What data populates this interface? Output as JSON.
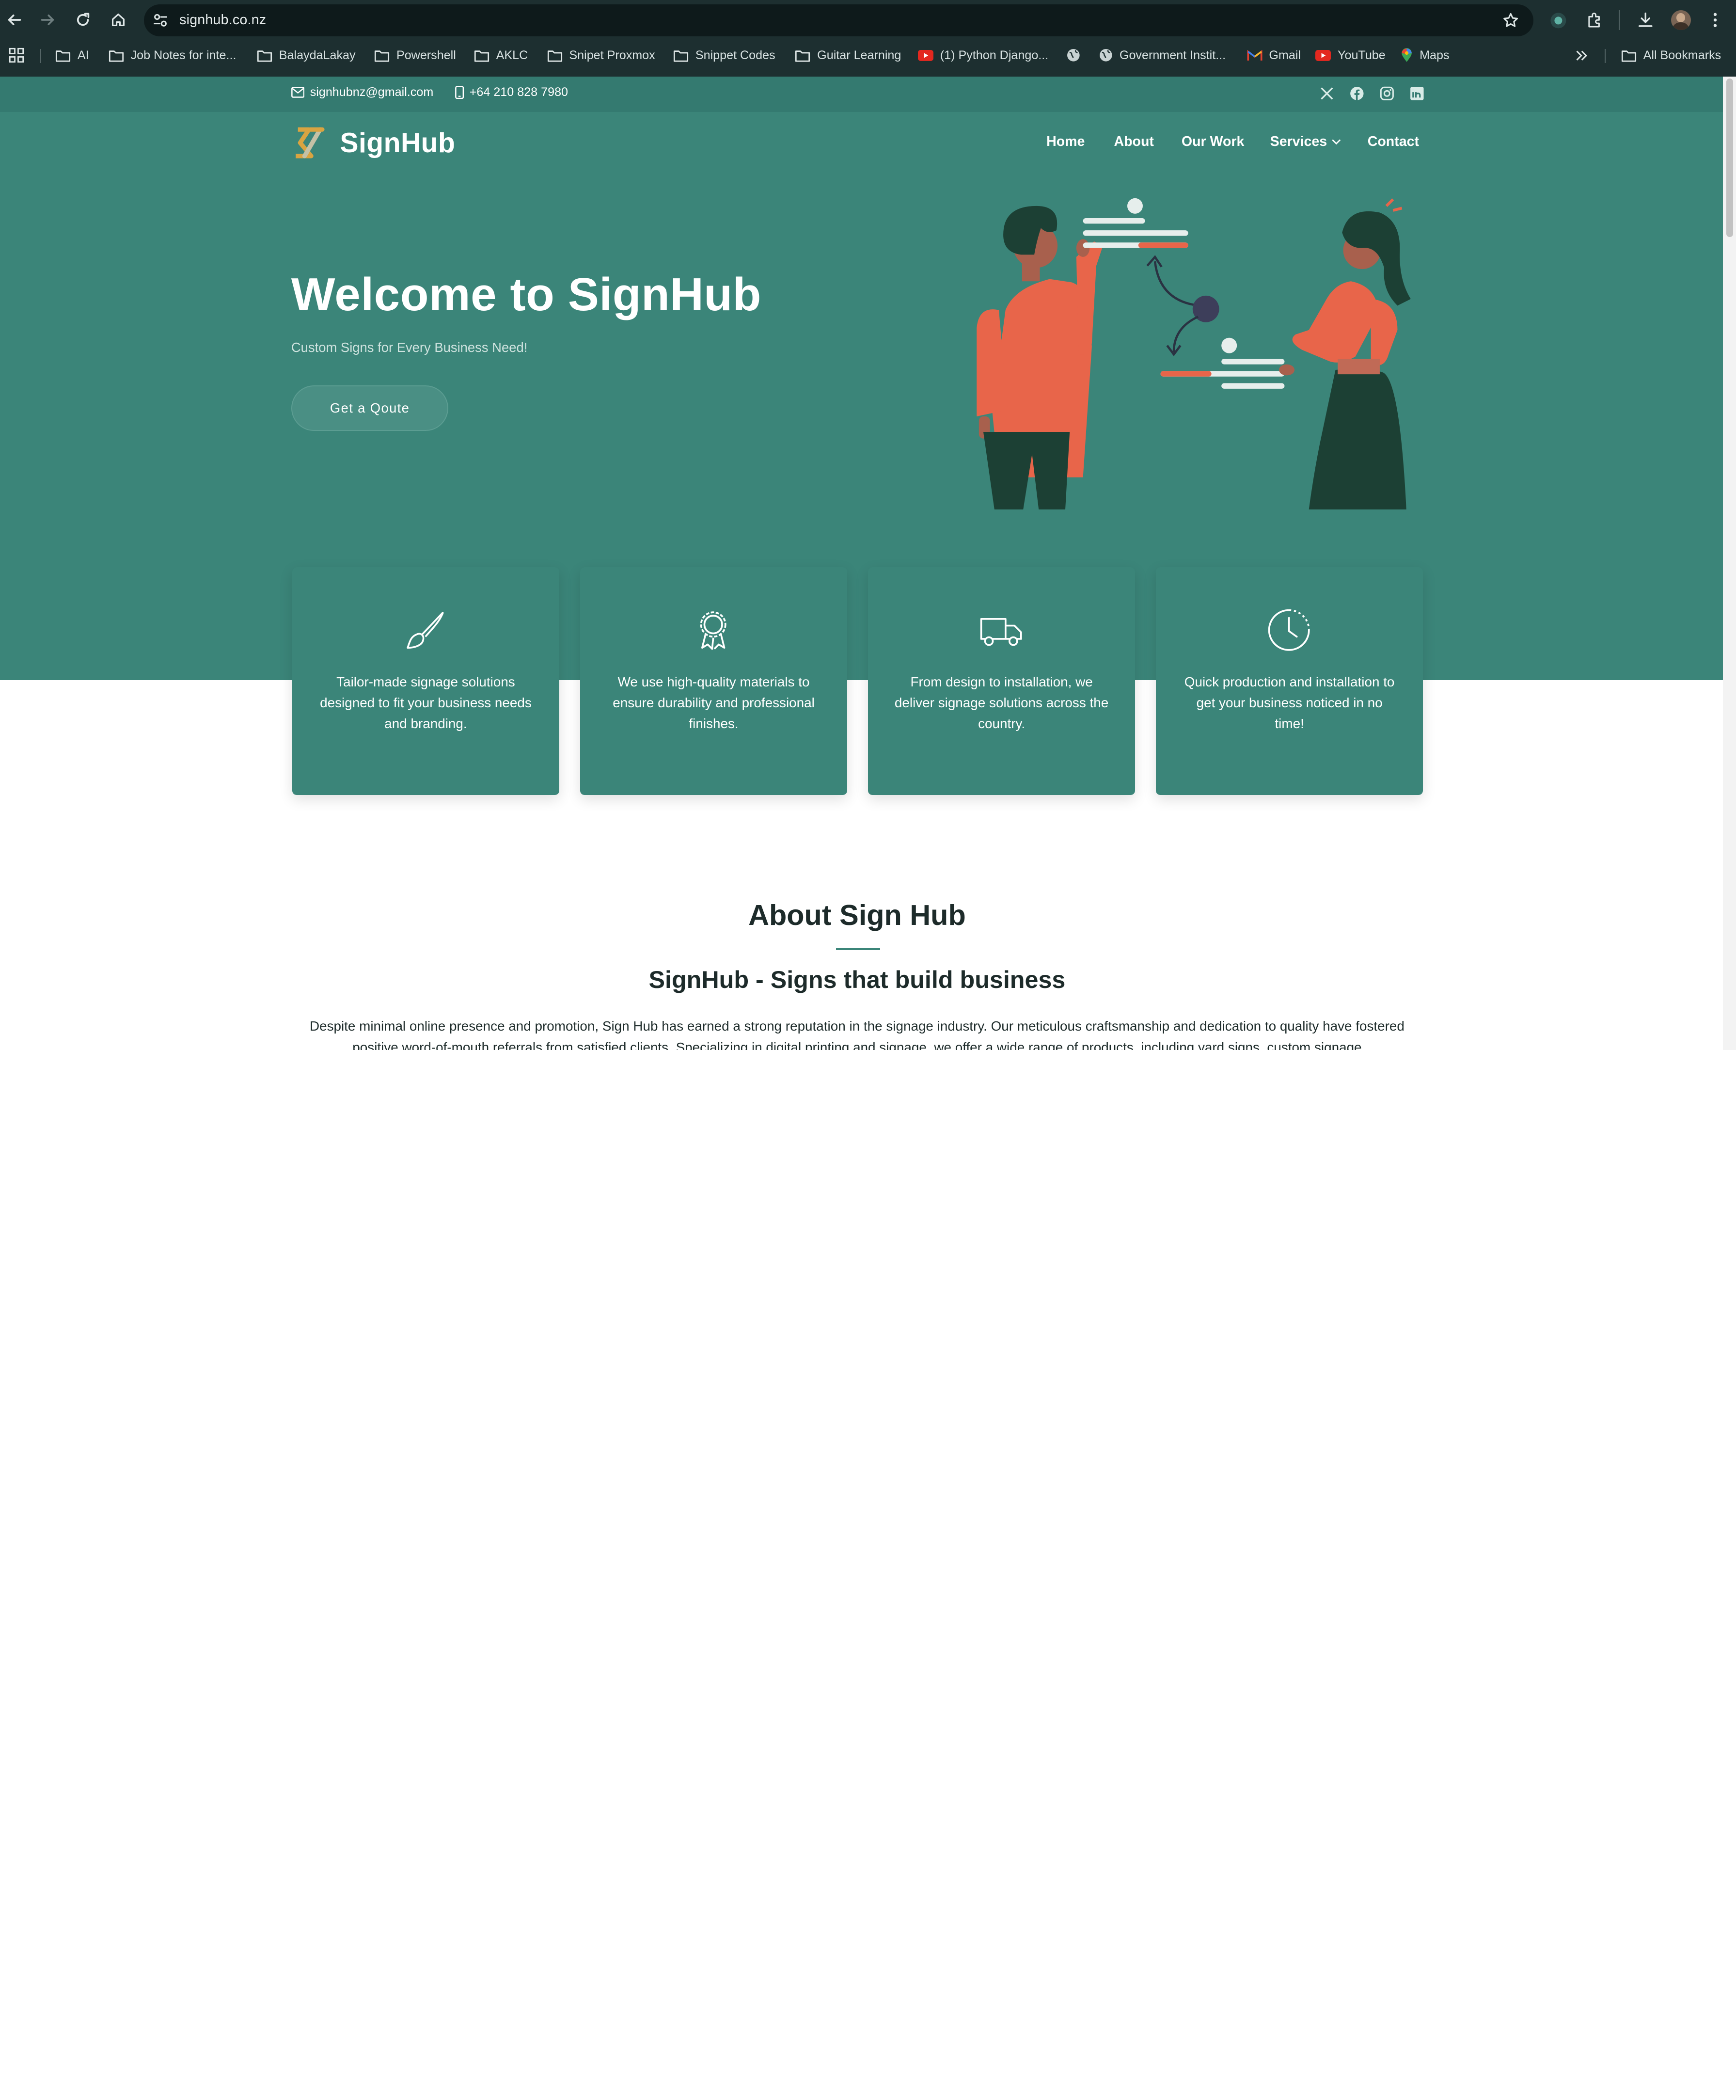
{
  "browser": {
    "url": "signhub.co.nz",
    "bookmarks": [
      {
        "label": "AI",
        "icon": "folder-icon"
      },
      {
        "label": "Job Notes for inte...",
        "icon": "folder-icon"
      },
      {
        "label": "BalaydaLakay",
        "icon": "folder-icon"
      },
      {
        "label": "Powershell",
        "icon": "folder-icon"
      },
      {
        "label": "AKLC",
        "icon": "folder-icon"
      },
      {
        "label": "Snipet Proxmox",
        "icon": "folder-icon"
      },
      {
        "label": "Snippet Codes",
        "icon": "folder-icon"
      },
      {
        "label": "Guitar Learning",
        "icon": "folder-icon"
      },
      {
        "label": "(1) Python Django...",
        "icon": "youtube-icon"
      },
      {
        "label": "",
        "icon": "globe-icon"
      },
      {
        "label": "Government Instit...",
        "icon": "globe-icon"
      },
      {
        "label": "Gmail",
        "icon": "gmail-icon"
      },
      {
        "label": "YouTube",
        "icon": "youtube-icon"
      },
      {
        "label": "Maps",
        "icon": "maps-icon"
      }
    ],
    "all_bookmarks": "All Bookmarks"
  },
  "site": {
    "topbar": {
      "email": "signhubnz@gmail.com",
      "phone": "+64 210 828 7980",
      "socials": [
        "x-icon",
        "facebook-icon",
        "instagram-icon",
        "linkedin-icon"
      ]
    },
    "brand": "SignHub",
    "nav": [
      "Home",
      "About",
      "Our Work",
      "Services",
      "Contact"
    ],
    "hero": {
      "title": "Welcome to SignHub",
      "subtitle": "Custom Signs for Every Business Need!",
      "cta": "Get a Qoute"
    },
    "features": [
      {
        "icon": "paintbrush-icon",
        "text": "Tailor-made signage solutions designed to fit your business needs and branding."
      },
      {
        "icon": "award-icon",
        "text": "We use high-quality materials to ensure durability and professional finishes."
      },
      {
        "icon": "truck-icon",
        "text": "From design to installation, we deliver signage solutions across the country."
      },
      {
        "icon": "clock-icon",
        "text": "Quick production and installation to get your business noticed in no time!"
      }
    ],
    "about": {
      "title": "About Sign Hub",
      "subtitle": "SignHub - Signs that build business",
      "body": "Despite minimal online presence and promotion, Sign Hub has earned a strong reputation in the signage industry. Our meticulous craftsmanship and dedication to quality have fostered positive word-of-mouth referrals from satisfied clients. Specializing in digital printing and signage, we offer a wide range of products, including yard signs, custom signage"
    }
  },
  "colors": {
    "brand_teal": "#3b8579",
    "topbar_teal": "#347a70",
    "accent_orange": "#e8654a",
    "logo_gold": "#d9a441"
  }
}
